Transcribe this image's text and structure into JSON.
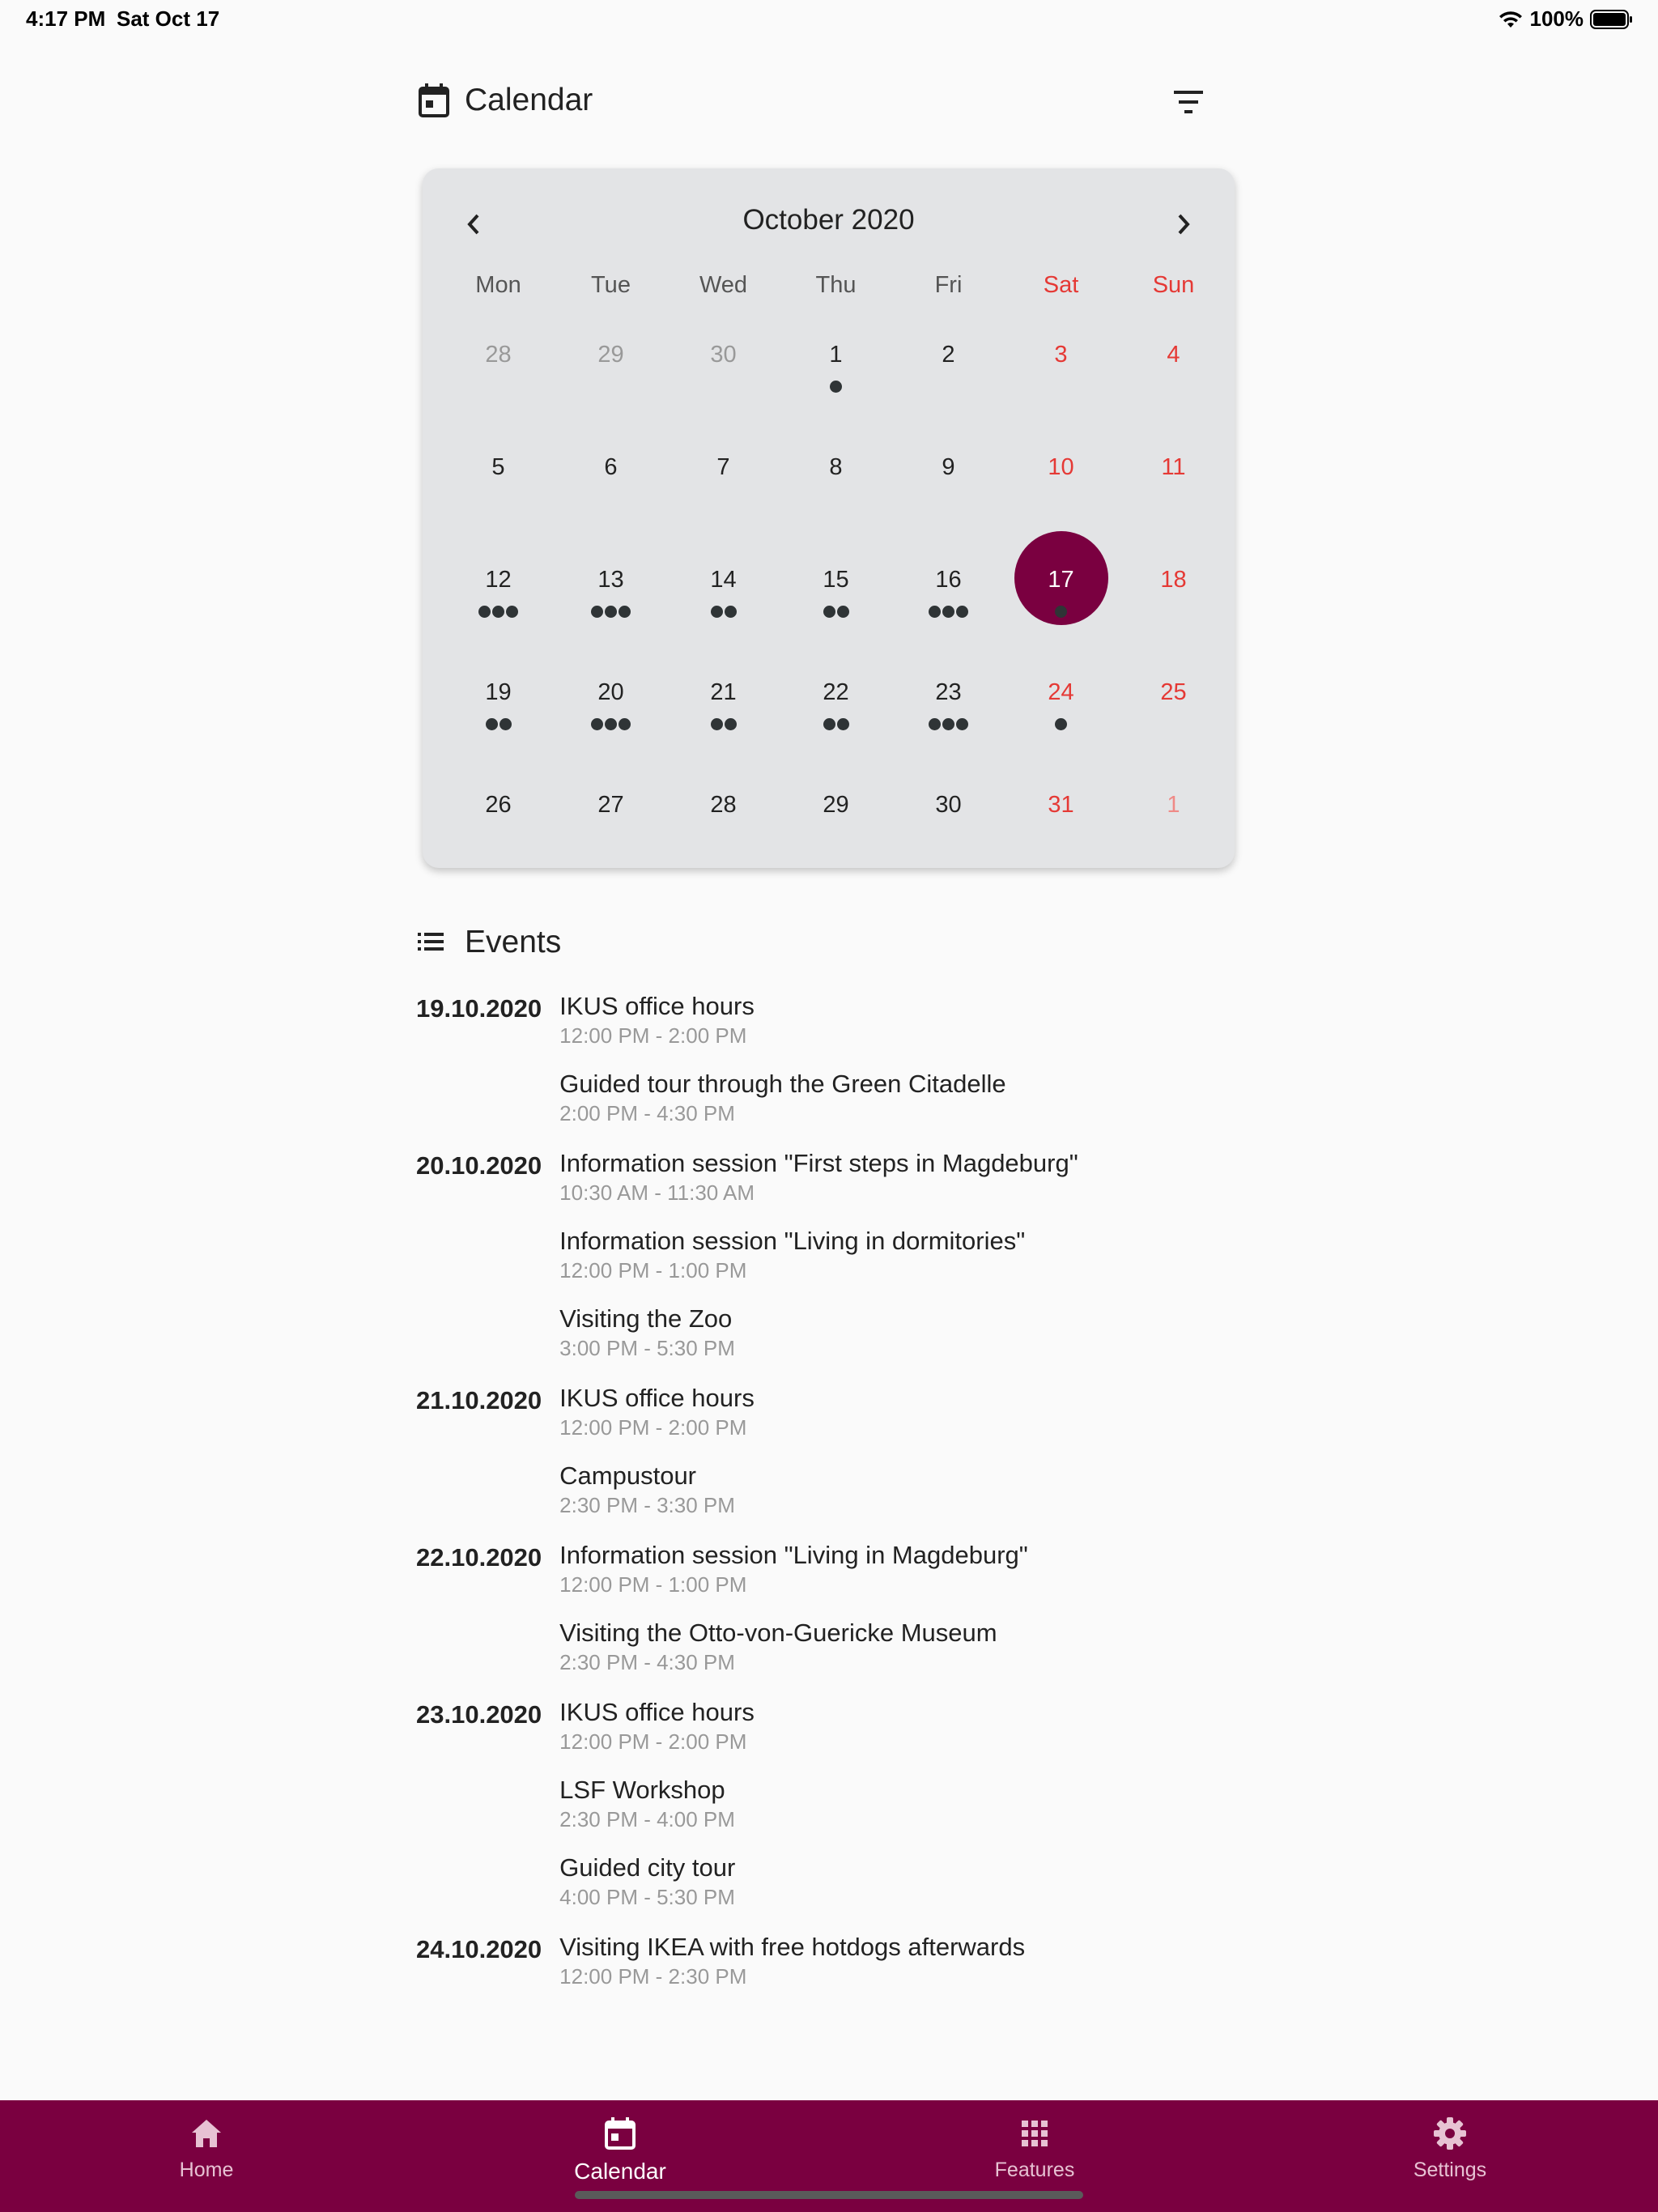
{
  "status_bar": {
    "time": "4:17 PM",
    "date": "Sat Oct 17",
    "battery": "100%"
  },
  "header": {
    "title": "Calendar",
    "icon": "calendar-icon",
    "filter_icon": "filter-icon"
  },
  "calendar": {
    "month_label": "October 2020",
    "weekdays": [
      "Mon",
      "Tue",
      "Wed",
      "Thu",
      "Fri",
      "Sat",
      "Sun"
    ],
    "weeks": [
      [
        {
          "d": "28",
          "muted": true,
          "dots": 0
        },
        {
          "d": "29",
          "muted": true,
          "dots": 0
        },
        {
          "d": "30",
          "muted": true,
          "dots": 0
        },
        {
          "d": "1",
          "dots": 1
        },
        {
          "d": "2",
          "dots": 0
        },
        {
          "d": "3",
          "dots": 0
        },
        {
          "d": "4",
          "dots": 0
        }
      ],
      [
        {
          "d": "5",
          "dots": 0
        },
        {
          "d": "6",
          "dots": 0
        },
        {
          "d": "7",
          "dots": 0
        },
        {
          "d": "8",
          "dots": 0
        },
        {
          "d": "9",
          "dots": 0
        },
        {
          "d": "10",
          "dots": 0
        },
        {
          "d": "11",
          "dots": 0
        }
      ],
      [
        {
          "d": "12",
          "dots": 3
        },
        {
          "d": "13",
          "dots": 3
        },
        {
          "d": "14",
          "dots": 2
        },
        {
          "d": "15",
          "dots": 2
        },
        {
          "d": "16",
          "dots": 3
        },
        {
          "d": "17",
          "dots": 1,
          "selected": true
        },
        {
          "d": "18",
          "dots": 0
        }
      ],
      [
        {
          "d": "19",
          "dots": 2
        },
        {
          "d": "20",
          "dots": 3
        },
        {
          "d": "21",
          "dots": 2
        },
        {
          "d": "22",
          "dots": 2
        },
        {
          "d": "23",
          "dots": 3
        },
        {
          "d": "24",
          "dots": 1
        },
        {
          "d": "25",
          "dots": 0
        }
      ],
      [
        {
          "d": "26",
          "dots": 0
        },
        {
          "d": "27",
          "dots": 0
        },
        {
          "d": "28",
          "dots": 0
        },
        {
          "d": "29",
          "dots": 0
        },
        {
          "d": "30",
          "dots": 0
        },
        {
          "d": "31",
          "dots": 0
        },
        {
          "d": "1",
          "muted": true,
          "dots": 0
        }
      ]
    ],
    "weekend_color": "#e53935",
    "selected_color": "#7a0040"
  },
  "events_section": {
    "title": "Events",
    "days": [
      {
        "date": "19.10.2020",
        "events": [
          {
            "title": "IKUS office hours",
            "time": "12:00 PM - 2:00 PM"
          },
          {
            "title": "Guided tour through the Green Citadelle",
            "time": "2:00 PM - 4:30 PM"
          }
        ]
      },
      {
        "date": "20.10.2020",
        "events": [
          {
            "title": "Information session \"First steps in Magdeburg\"",
            "time": "10:30 AM - 11:30 AM"
          },
          {
            "title": "Information session \"Living in dormitories\"",
            "time": "12:00 PM - 1:00 PM"
          },
          {
            "title": "Visiting the Zoo",
            "time": "3:00 PM - 5:30 PM"
          }
        ]
      },
      {
        "date": "21.10.2020",
        "events": [
          {
            "title": "IKUS office hours",
            "time": "12:00 PM - 2:00 PM"
          },
          {
            "title": "Campustour",
            "time": "2:30 PM - 3:30 PM"
          }
        ]
      },
      {
        "date": "22.10.2020",
        "events": [
          {
            "title": "Information session \"Living in Magdeburg\"",
            "time": "12:00 PM - 1:00 PM"
          },
          {
            "title": "Visiting the Otto-von-Guericke Museum",
            "time": "2:30 PM - 4:30 PM"
          }
        ]
      },
      {
        "date": "23.10.2020",
        "events": [
          {
            "title": "IKUS office hours",
            "time": "12:00 PM - 2:00 PM"
          },
          {
            "title": "LSF Workshop",
            "time": "2:30 PM - 4:00 PM"
          },
          {
            "title": "Guided city tour",
            "time": "4:00 PM - 5:30 PM"
          }
        ]
      },
      {
        "date": "24.10.2020",
        "events": [
          {
            "title": "Visiting IKEA with free hotdogs afterwards",
            "time": "12:00 PM - 2:30 PM"
          }
        ]
      }
    ]
  },
  "bottom_nav": {
    "color": "#7a0040",
    "items": [
      {
        "label": "Home",
        "icon": "home-icon"
      },
      {
        "label": "Calendar",
        "icon": "calendar-icon",
        "active": true
      },
      {
        "label": "Features",
        "icon": "grid-icon"
      },
      {
        "label": "Settings",
        "icon": "gear-icon"
      }
    ]
  }
}
